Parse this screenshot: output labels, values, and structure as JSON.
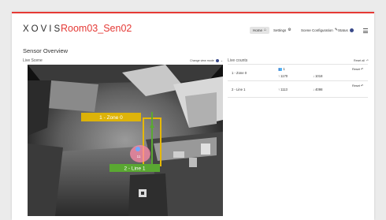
{
  "app": {
    "brand": "XOVIS",
    "device_name": "Room03_Sen02",
    "accent_color": "#e53935"
  },
  "nav": {
    "home": "Home",
    "settings": "Settings",
    "scene_config": "Scene Configuration",
    "status": "Status"
  },
  "page": {
    "title": "Sensor Overview",
    "live_scene": "Live Scene",
    "change_view": "Change view mode",
    "live_counts": "Live counts",
    "reset_all": "Reset all"
  },
  "overlay": {
    "zone_label": "1 - Zone 0",
    "line_label": "2 - Line 1",
    "person_id": "11",
    "zone_color": "#e6b800",
    "line_color": "#5aa832"
  },
  "counts": [
    {
      "name": "1 - Zone 0",
      "group_count": "1",
      "in": "1170",
      "out": "1018",
      "reset": "Reset"
    },
    {
      "name": "2 - Line 1",
      "in": "1113",
      "out": "4098",
      "reset": "Reset"
    }
  ]
}
